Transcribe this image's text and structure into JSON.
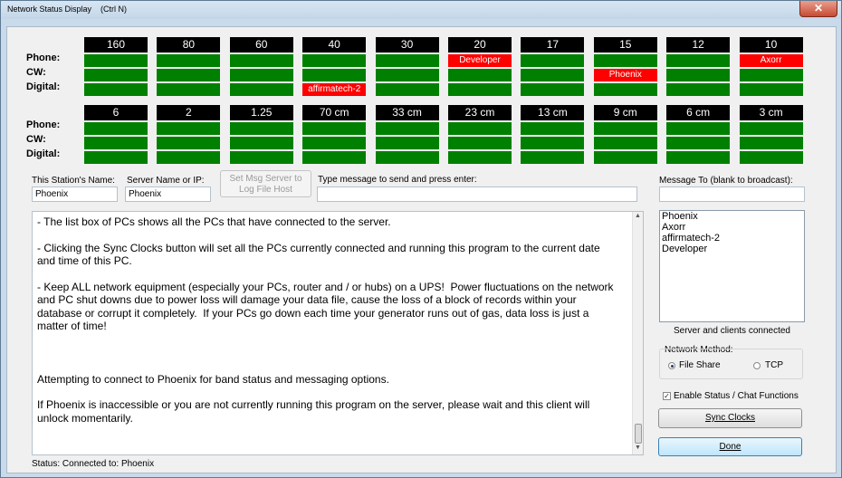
{
  "window": {
    "title": "Network Status Display    (Ctrl N)",
    "close_glyph": "✕"
  },
  "row_labels": {
    "phone": "Phone:",
    "cw": "CW:",
    "digital": "Digital:"
  },
  "bands_row1": [
    {
      "name": "160",
      "phone": "",
      "cw": "",
      "digital": ""
    },
    {
      "name": "80",
      "phone": "",
      "cw": "",
      "digital": ""
    },
    {
      "name": "60",
      "phone": "",
      "cw": "",
      "digital": ""
    },
    {
      "name": "40",
      "phone": "",
      "cw": "",
      "digital": "affirmatech-2"
    },
    {
      "name": "30",
      "phone": "",
      "cw": "",
      "digital": ""
    },
    {
      "name": "20",
      "phone": "Developer",
      "cw": "",
      "digital": ""
    },
    {
      "name": "17",
      "phone": "",
      "cw": "",
      "digital": ""
    },
    {
      "name": "15",
      "phone": "",
      "cw": "Phoenix",
      "digital": ""
    },
    {
      "name": "12",
      "phone": "",
      "cw": "",
      "digital": ""
    },
    {
      "name": "10",
      "phone": "Axorr",
      "cw": "",
      "digital": ""
    }
  ],
  "bands_row2": [
    {
      "name": "6",
      "phone": "",
      "cw": "",
      "digital": ""
    },
    {
      "name": "2",
      "phone": "",
      "cw": "",
      "digital": ""
    },
    {
      "name": "1.25",
      "phone": "",
      "cw": "",
      "digital": ""
    },
    {
      "name": "70 cm",
      "phone": "",
      "cw": "",
      "digital": ""
    },
    {
      "name": "33 cm",
      "phone": "",
      "cw": "",
      "digital": ""
    },
    {
      "name": "23 cm",
      "phone": "",
      "cw": "",
      "digital": ""
    },
    {
      "name": "13 cm",
      "phone": "",
      "cw": "",
      "digital": ""
    },
    {
      "name": "9 cm",
      "phone": "",
      "cw": "",
      "digital": ""
    },
    {
      "name": "6 cm",
      "phone": "",
      "cw": "",
      "digital": ""
    },
    {
      "name": "3 cm",
      "phone": "",
      "cw": "",
      "digital": ""
    }
  ],
  "colors": {
    "idle": "#008000",
    "active": "#ff0000",
    "header": "#000000"
  },
  "station": {
    "name_label": "This Station's Name:",
    "name_value": "Phoenix",
    "server_label": "Server Name or IP:",
    "server_value": "Phoenix",
    "set_server_button": "Set Msg Server to Log File Host",
    "message_label": "Type message to send and press enter:",
    "message_value": ""
  },
  "message_to": {
    "label": "Message To (blank to broadcast):",
    "value": ""
  },
  "log_paragraphs": [
    "- The list box of PCs shows all the PCs that have connected to the server.",
    "- Clicking the Sync Clocks button will set all the PCs currently connected and running this program to the current date and time of this PC.",
    "- Keep ALL network equipment (especially your PCs, router and / or hubs) on a UPS!  Power fluctuations on the network and PC shut downs due to power loss will damage your data file, cause the loss of a block of records within your database or corrupt it completely.  If your PCs go down each time your generator runs out of gas, data loss is just a matter of time!",
    "Attempting to connect to Phoenix for band status and messaging options.",
    "If Phoenix is inaccessible or you are not currently running this program on the server, please wait and this client will unlock momentarily."
  ],
  "clients": [
    "Phoenix",
    "Axorr",
    "affirmatech-2",
    "Developer"
  ],
  "clients_caption": "Server and clients connected",
  "network_method": {
    "label": "Network Method:",
    "options": [
      "File Share",
      "TCP"
    ],
    "selected": "File Share"
  },
  "enable_status": {
    "label": "Enable Status /  Chat Functions",
    "checked": true
  },
  "buttons": {
    "sync_clocks": "Sync Clocks",
    "done": "Done"
  },
  "status": "Status: Connected to: Phoenix"
}
